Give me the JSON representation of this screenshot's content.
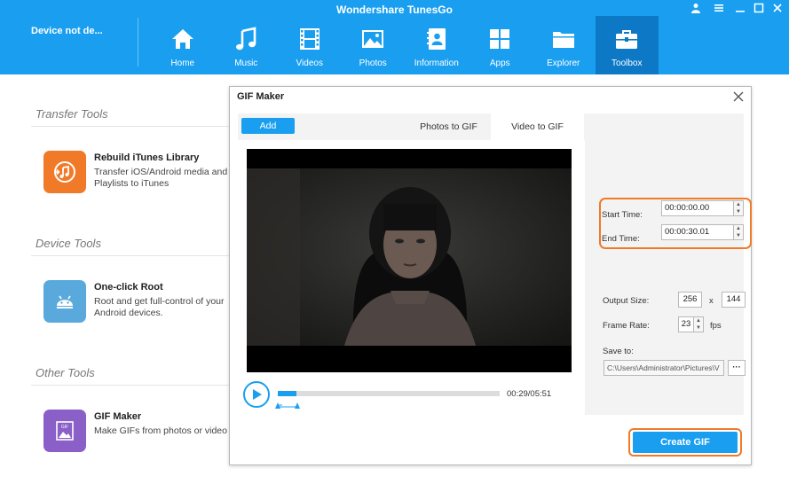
{
  "app": {
    "title": "Wondershare TunesGo",
    "device_status": "Device not de..."
  },
  "nav": {
    "items": [
      {
        "label": "Home",
        "icon": "home-icon"
      },
      {
        "label": "Music",
        "icon": "music-icon"
      },
      {
        "label": "Videos",
        "icon": "film-icon"
      },
      {
        "label": "Photos",
        "icon": "photo-icon"
      },
      {
        "label": "Information",
        "icon": "contacts-icon"
      },
      {
        "label": "Apps",
        "icon": "apps-icon"
      },
      {
        "label": "Explorer",
        "icon": "folder-icon"
      },
      {
        "label": "Toolbox",
        "icon": "toolbox-icon"
      }
    ],
    "active": "Toolbox"
  },
  "toolbox": {
    "sections": [
      {
        "title": "Transfer Tools",
        "tools": [
          {
            "name": "Rebuild iTunes Library",
            "desc_line1": "Transfer iOS/Android media and",
            "desc_line2": "Playlists to iTunes",
            "icon": "itunes-rebuild-icon",
            "color": "#f07a28"
          }
        ]
      },
      {
        "title": "Device Tools",
        "tools": [
          {
            "name": "One-click Root",
            "desc_line1": "Root and get full-control of your",
            "desc_line2": "Android devices.",
            "icon": "android-root-icon",
            "color": "#5aa9dc"
          }
        ]
      },
      {
        "title": "Other Tools",
        "tools": [
          {
            "name": "GIF Maker",
            "desc_line1": "Make GIFs from photos or video",
            "desc_line2": "",
            "icon": "gif-icon",
            "color": "#8a5fc8"
          }
        ]
      }
    ]
  },
  "dialog": {
    "title": "GIF Maker",
    "add_label": "Add",
    "tabs": [
      {
        "label": "Photos to GIF"
      },
      {
        "label": "Video to GIF"
      }
    ],
    "active_tab": "Video to GIF",
    "player": {
      "time": "00:29/05:51",
      "progress": 0.085
    },
    "start_time_label": "Start Time:",
    "start_time": "00:00:00.00",
    "end_time_label": "End Time:",
    "end_time": "00:00:30.01",
    "output_size_label": "Output Size:",
    "width": "256",
    "size_sep": "x",
    "height": "144",
    "frame_rate_label": "Frame Rate:",
    "frame_rate": "23",
    "fps_label": "fps",
    "save_to_label": "Save to:",
    "save_path": "C:\\Users\\Administrator\\Pictures\\V",
    "browse_label": "···",
    "create_label": "Create GIF"
  },
  "colors": {
    "accent": "#1a9ff0",
    "active_nav": "#0d79c6",
    "highlight": "#f07a28"
  }
}
